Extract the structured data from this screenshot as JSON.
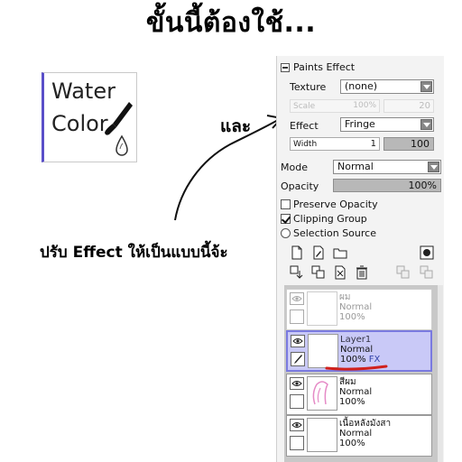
{
  "title": "ขั้นนี้ต้องใช้...",
  "tool": {
    "line1": "Water",
    "line2": "Color",
    "icon": "brush-water-drop-icon"
  },
  "annotations": {
    "and": "และ",
    "adjust": "ปรับ Effect ให้เป็นแบบนี้จ้ะ"
  },
  "panel": {
    "section_title": "Paints Effect",
    "texture": {
      "label": "Texture",
      "value": "(none)"
    },
    "scale": {
      "label": "Scale",
      "percent": "100%",
      "value": "20"
    },
    "effect": {
      "label": "Effect",
      "value": "Fringe"
    },
    "width": {
      "label": "Width",
      "value": "1",
      "max": "100"
    },
    "mode": {
      "label": "Mode",
      "value": "Normal"
    },
    "opacity": {
      "label": "Opacity",
      "value": "100%"
    },
    "options": {
      "preserve_opacity": "Preserve Opacity",
      "clipping_group": "Clipping Group",
      "selection_source": "Selection Source"
    },
    "layers": [
      {
        "name": "ผม",
        "mode": "Normal",
        "opacity": "100%"
      },
      {
        "name": "Layer1",
        "mode": "Normal",
        "opacity": "100%",
        "fx": "FX"
      },
      {
        "name": "สีผม",
        "mode": "Normal",
        "opacity": "100%"
      },
      {
        "name": "เนื้อหลังมังสา",
        "mode": "Normal",
        "opacity": "100%"
      }
    ]
  },
  "colors": {
    "accent": "#5a4fc9",
    "active_layer": "#c9c9f7",
    "underline": "#d0201c"
  }
}
